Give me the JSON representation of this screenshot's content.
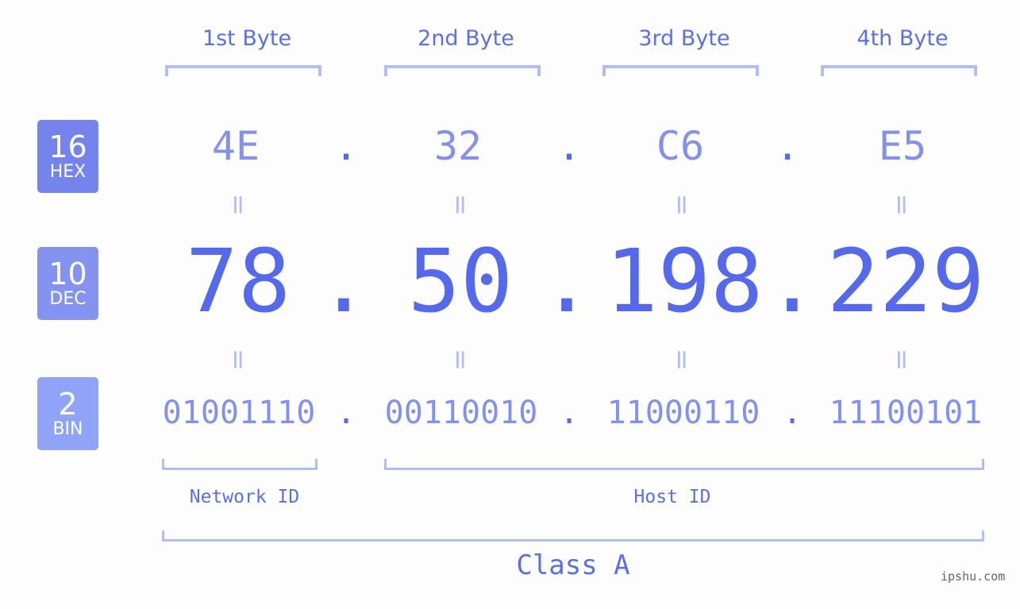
{
  "byte_headers": [
    "1st Byte",
    "2nd Byte",
    "3rd Byte",
    "4th Byte"
  ],
  "badges": [
    {
      "number": "16",
      "label": "HEX",
      "color": "#7584ec"
    },
    {
      "number": "10",
      "label": "DEC",
      "color": "#8493f0"
    },
    {
      "number": "2",
      "label": "BIN",
      "color": "#8fa4f7"
    }
  ],
  "hex": [
    "4E",
    "32",
    "C6",
    "E5"
  ],
  "dec": [
    "78",
    "50",
    "198",
    "229"
  ],
  "bin": [
    "01001110",
    "00110010",
    "11000110",
    "11100101"
  ],
  "separator": ".",
  "equals": "=",
  "segments": {
    "network": "Network ID",
    "host": "Host ID"
  },
  "class_label": "Class A",
  "footer": "ipshu.com",
  "colors": {
    "accent": "#5569ec",
    "light": "#8491ec",
    "bracket": "#b3bcf6"
  }
}
